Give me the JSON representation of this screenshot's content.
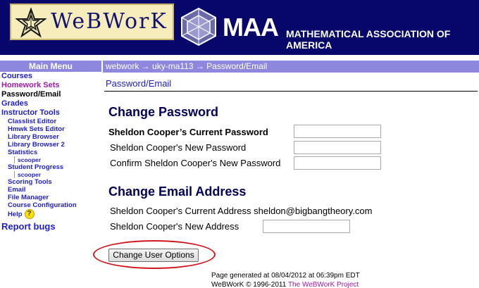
{
  "banner": {
    "webwork_logo_text": "WeBWorK",
    "maa_logo_text": "MAA",
    "maa_full_name": "MATHEMATICAL ASSOCIATION OF AMERICA",
    "background_color": "#06066b"
  },
  "menu": {
    "title": "Main Menu",
    "courses": "Courses",
    "homework_sets": "Homework Sets",
    "password_email": "Password/Email",
    "grades": "Grades",
    "instructor_tools": "Instructor Tools",
    "classlist_editor": "Classlist Editor",
    "hmwk_sets_editor": "Hmwk Sets Editor",
    "library_browser": "Library Browser",
    "library_browser_2": "Library Browser 2",
    "statistics": "Statistics",
    "statistics_user": "scooper",
    "student_progress": "Student Progress",
    "student_progress_user": "scooper",
    "scoring_tools": "Scoring Tools",
    "email": "Email",
    "file_manager": "File Manager",
    "course_configuration": "Course Configuration",
    "help": "Help",
    "report_bugs": "Report bugs"
  },
  "breadcrumb": {
    "text": "webwork → uky-ma113 → Password/Email"
  },
  "page_link": "Password/Email",
  "change_password": {
    "heading": "Change Password",
    "current_label": "Sheldon Cooper’s Current Password",
    "new_label": "Sheldon Cooper's New Password",
    "confirm_label": "Confirm Sheldon Cooper's New Password",
    "current_value": "",
    "new_value": "",
    "confirm_value": ""
  },
  "change_email": {
    "heading": "Change Email Address",
    "current_address_label": "Sheldon Cooper's Current Address",
    "current_address": "sheldon@bigbangtheory.com",
    "new_address_label": "Sheldon Cooper's New Address",
    "new_address_value": ""
  },
  "submit_label": "Change User Options",
  "footer": {
    "generated": "Page generated at 08/04/2012 at 06:39pm EDT",
    "copyright": "WeBWorK © 1996-2011",
    "project_link": "The WeBWorK Project"
  },
  "colors": {
    "link": "#1d1dcc",
    "visited_link": "#9d1ba5",
    "bar": "#8d87dd",
    "highlight_ellipse": "#d0171d"
  }
}
